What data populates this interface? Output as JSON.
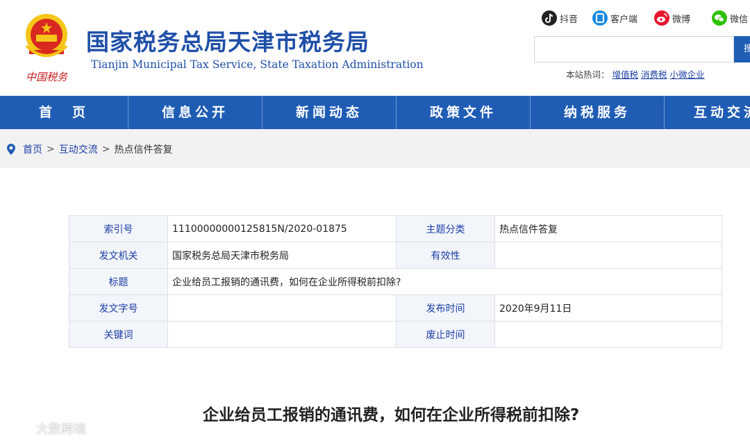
{
  "header": {
    "emblem_text": "中国税务",
    "title_cn": "国家税务总局天津市税务局",
    "title_en": "Tianjin Municipal Tax Service, State Taxation Administration",
    "social": [
      {
        "label": "抖音",
        "icon": "douyin-icon",
        "color": "#222222"
      },
      {
        "label": "客户端",
        "icon": "mobile-client-icon",
        "color": "#1c8be0"
      },
      {
        "label": "微博",
        "icon": "weibo-icon",
        "color": "#e6162d"
      },
      {
        "label": "微信",
        "icon": "wechat-icon",
        "color": "#2dc100"
      }
    ],
    "search_button": "搜",
    "hotwords_label": "本站热词：",
    "hotwords": [
      "增值税",
      "消费税",
      "小微企业"
    ]
  },
  "nav": [
    "首　页",
    "信息公开",
    "新闻动态",
    "政策文件",
    "纳税服务",
    "互动交流"
  ],
  "breadcrumb": [
    "首页",
    "互动交流",
    "热点信件答复"
  ],
  "meta": {
    "index_no_label": "索引号",
    "index_no": "11100000000125815N/2020-01875",
    "topic_label": "主题分类",
    "topic": "热点信件答复",
    "issuer_label": "发文机关",
    "issuer": "国家税务总局天津市税务局",
    "validity_label": "有效性",
    "validity": "",
    "title_label": "标题",
    "title": "企业给员工报销的通讯费，如何在企业所得税前扣除?",
    "doc_no_label": "发文字号",
    "doc_no": "",
    "publish_label": "发布时间",
    "publish": "2020年9月11日",
    "keywords_label": "关键词",
    "keywords": "",
    "expire_label": "废止时间",
    "expire": ""
  },
  "article_title": "企业给员工报销的通讯费，如何在企业所得税前扣除?",
  "watermark": "大数跨境",
  "colors": {
    "brand_blue": "#1f5db5",
    "title_blue": "#1f4fa8",
    "link_blue": "#1c3ea6"
  }
}
